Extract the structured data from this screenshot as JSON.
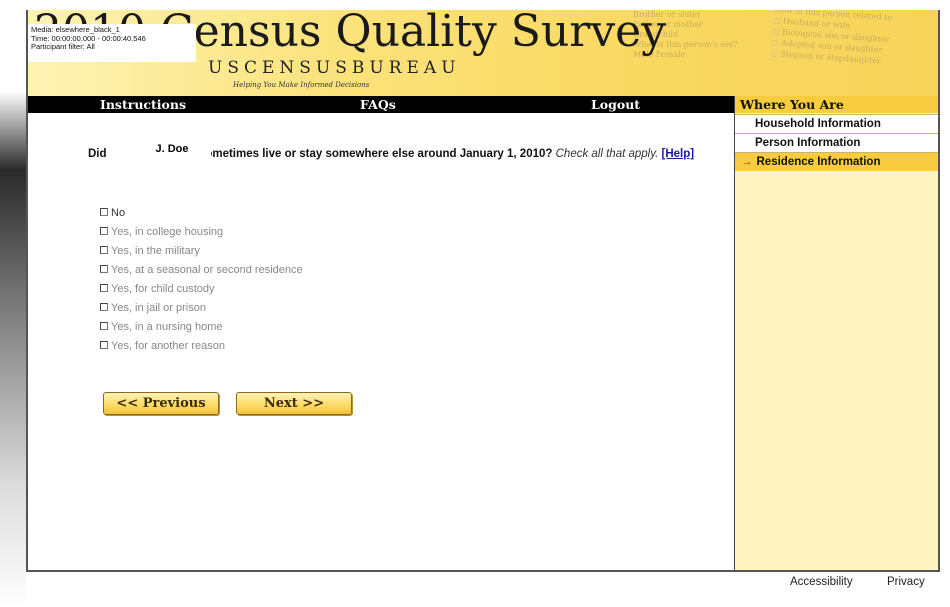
{
  "banner": {
    "title": "2010 Census Quality Survey",
    "bureau": "USCENSUSBUREAU",
    "tagline": "Helping You Make Informed Decisions",
    "background_form_lines_1": [
      "Brother or sister",
      "Father or mother",
      "Grandchild",
      "What is this person's sex?",
      "Male   Female"
    ],
    "background_form_lines_2": [
      "How is this person related to",
      "Husband or wife",
      "Biological son or daughter",
      "Adopted son or daughter",
      "Stepson or stepdaughter"
    ]
  },
  "media_overlay": {
    "media": "Media: elsewhere_black_1",
    "time": "Time: 00:00:00.000 - 00:00:40.546",
    "filter": "Participant filter: All"
  },
  "nav": {
    "instructions": "Instructions",
    "faqs": "FAQs",
    "logout": "Logout"
  },
  "sidebar": {
    "heading": "Where You Are",
    "items": [
      "Household Information",
      "Person Information",
      "Residence Information"
    ],
    "current_arrow": "→"
  },
  "question": {
    "did": "Did",
    "name": "J. Doe",
    "main": "sometimes live or stay somewhere else around January 1, 2010?",
    "check": "Check all that apply.",
    "help": "[Help]"
  },
  "options": [
    "No",
    "Yes, in college housing",
    "Yes, in the military",
    "Yes, at a seasonal or second residence",
    "Yes, for child custody",
    "Yes, in jail or prison",
    "Yes, in a nursing home",
    "Yes, for another reason"
  ],
  "buttons": {
    "previous": "<< Previous",
    "next": "Next >>"
  },
  "footer": {
    "accessibility": "Accessibility",
    "privacy": "Privacy"
  },
  "colors": {
    "banner_gold": "#f9d85f",
    "sidebar_bg": "#fff4c0",
    "highlight": "#f7cc3f",
    "nav_bg": "#000000",
    "help_link": "#1a1a9c"
  }
}
